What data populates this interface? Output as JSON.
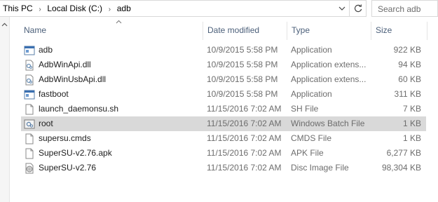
{
  "address": {
    "crumbs": [
      "This PC",
      "Local Disk (C:)",
      "adb"
    ]
  },
  "search": {
    "placeholder": "Search adb"
  },
  "columns": {
    "name": "Name",
    "date": "Date modified",
    "type": "Type",
    "size": "Size"
  },
  "files": [
    {
      "name": "adb",
      "date": "10/9/2015 5:58 PM",
      "type": "Application",
      "size": "922 KB",
      "icon": "application-icon"
    },
    {
      "name": "AdbWinApi.dll",
      "date": "10/9/2015 5:58 PM",
      "type": "Application extens...",
      "size": "94 KB",
      "icon": "dll-icon"
    },
    {
      "name": "AdbWinUsbApi.dll",
      "date": "10/9/2015 5:58 PM",
      "type": "Application extens...",
      "size": "60 KB",
      "icon": "dll-icon"
    },
    {
      "name": "fastboot",
      "date": "10/9/2015 5:58 PM",
      "type": "Application",
      "size": "311 KB",
      "icon": "application-icon"
    },
    {
      "name": "launch_daemonsu.sh",
      "date": "11/15/2016 7:02 AM",
      "type": "SH File",
      "size": "7 KB",
      "icon": "file-icon"
    },
    {
      "name": "root",
      "date": "11/15/2016 7:02 AM",
      "type": "Windows Batch File",
      "size": "1 KB",
      "icon": "batch-file-icon"
    },
    {
      "name": "supersu.cmds",
      "date": "11/15/2016 7:02 AM",
      "type": "CMDS File",
      "size": "1 KB",
      "icon": "file-icon"
    },
    {
      "name": "SuperSU-v2.76.apk",
      "date": "11/15/2016 7:02 AM",
      "type": "APK File",
      "size": "6,277 KB",
      "icon": "file-icon"
    },
    {
      "name": "SuperSU-v2.76",
      "date": "11/15/2016 7:02 AM",
      "type": "Disc Image File",
      "size": "98,304 KB",
      "icon": "disc-image-icon"
    }
  ],
  "selected_row": "root"
}
